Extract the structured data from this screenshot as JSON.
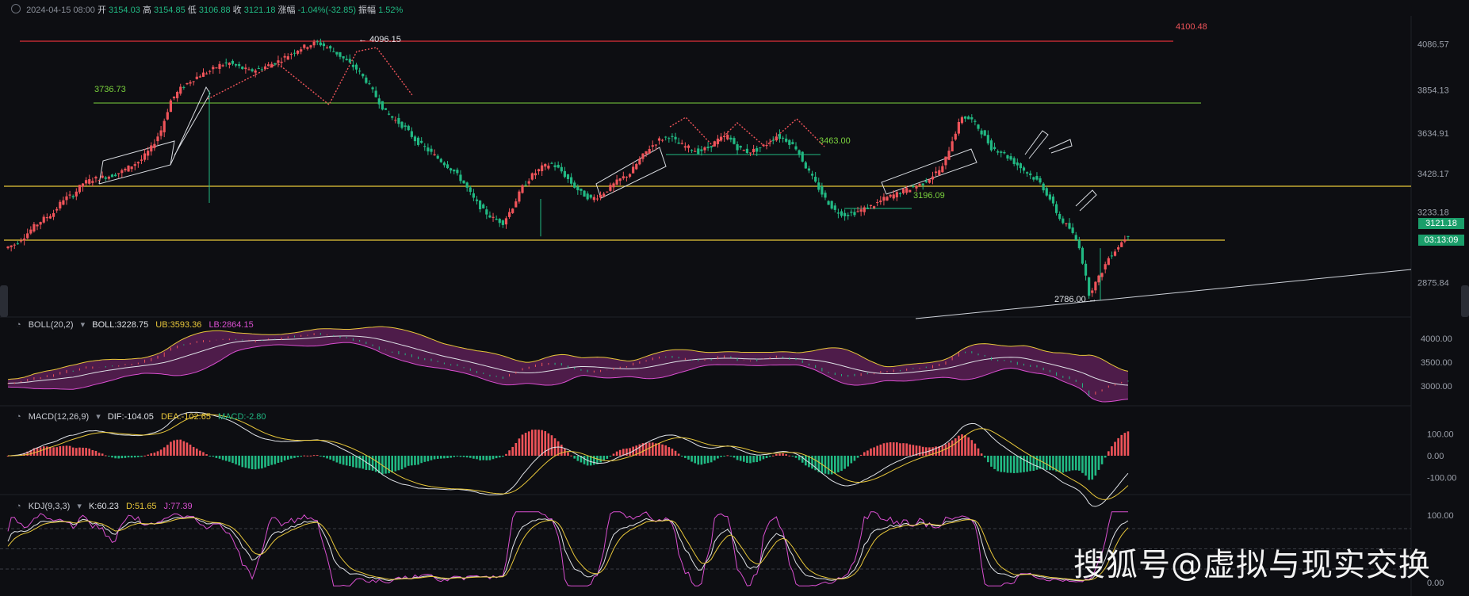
{
  "header": {
    "datetime": "2024-04-15 08:00",
    "open_label": "开",
    "open": "3154.03",
    "high_label": "高",
    "high": "3154.85",
    "low_label": "低",
    "low": "3106.88",
    "close_label": "收",
    "close": "3121.18",
    "change_label": "涨幅",
    "change": "-1.04%(-32.85)",
    "amplitude_label": "振幅",
    "amplitude": "1.52%"
  },
  "price_tags": {
    "last_price": "3121.18",
    "countdown": "03:13:09"
  },
  "annotations": {
    "top_line": "4100.48",
    "peak": "4096.15",
    "level_3736": "3736.73",
    "level_3463": "3463.00",
    "level_3196": "3196.09",
    "low": "2786.00"
  },
  "boll_legend": {
    "name": "BOLL(20,2)",
    "boll": "BOLL:3228.75",
    "ub": "UB:3593.36",
    "lb": "LB:2864.15"
  },
  "macd_legend": {
    "name": "MACD(12,26,9)",
    "dif": "DIF:-104.05",
    "dea": "DEA:-102.65",
    "macd": "MACD:-2.80"
  },
  "kdj_legend": {
    "name": "KDJ(9,3,3)",
    "k": "K:60.23",
    "d": "D:51.65",
    "j": "J:77.39"
  },
  "watermark": "搜狐号@虚拟与现实交换",
  "colors": {
    "up": "#f0545a",
    "down": "#21b983",
    "yellow": "#e8c73a",
    "magenta": "#d94fd0",
    "green_line": "#7bd23d",
    "red_line": "#e0303a"
  },
  "chart_data": {
    "type": "candlestick",
    "price_axis_ticks": [
      4086.57,
      3854.13,
      3634.91,
      3428.17,
      3233.18,
      2875.84
    ],
    "boll_axis_ticks": [
      4000.0,
      3500.0,
      3000.0
    ],
    "macd_axis_ticks": [
      100.0,
      0.0,
      -100.0
    ],
    "kdj_axis_ticks": [
      100.0,
      0.0
    ],
    "horizontal_levels": [
      4100.48,
      3736.73,
      3300,
      3110
    ],
    "close_series": [
      3050,
      3070,
      3110,
      3160,
      3200,
      3230,
      3300,
      3320,
      3380,
      3400,
      3410,
      3420,
      3440,
      3470,
      3500,
      3560,
      3650,
      3800,
      3860,
      3900,
      3930,
      3950,
      3980,
      3990,
      3970,
      3950,
      3960,
      3980,
      4000,
      4030,
      4060,
      4080,
      4096,
      4070,
      4040,
      4000,
      3960,
      3900,
      3820,
      3740,
      3700,
      3660,
      3600,
      3560,
      3520,
      3480,
      3440,
      3380,
      3300,
      3240,
      3200,
      3180,
      3260,
      3360,
      3420,
      3460,
      3480,
      3440,
      3380,
      3330,
      3300,
      3320,
      3360,
      3400,
      3430,
      3500,
      3560,
      3600,
      3620,
      3580,
      3560,
      3540,
      3560,
      3600,
      3620,
      3560,
      3540,
      3550,
      3580,
      3620,
      3600,
      3560,
      3463,
      3380,
      3300,
      3240,
      3220,
      3230,
      3250,
      3270,
      3300,
      3320,
      3340,
      3360,
      3380,
      3420,
      3460,
      3600,
      3720,
      3700,
      3640,
      3560,
      3540,
      3500,
      3460,
      3420,
      3380,
      3300,
      3200,
      3150,
      3060,
      2820,
      2900,
      3000,
      3060,
      3121.18
    ]
  }
}
